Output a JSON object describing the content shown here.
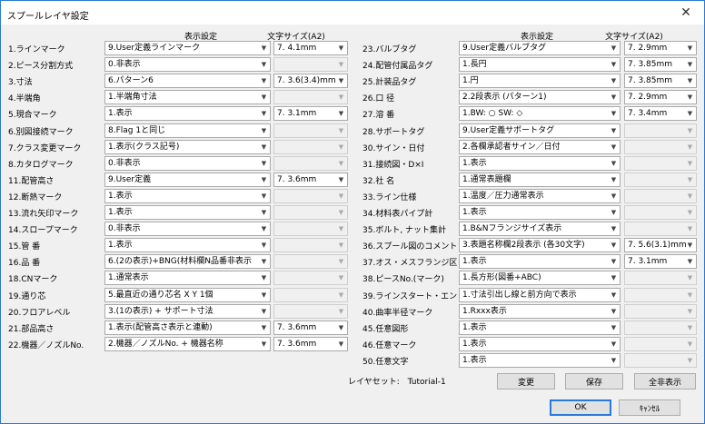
{
  "window": {
    "title": "スプールレイヤ設定",
    "close_glyph": "✕"
  },
  "headers": {
    "left_display": "表示設定",
    "left_size": "文字サイズ(A2)",
    "right_display": "表示設定",
    "right_size": "文字サイズ(A2)"
  },
  "left_rows": [
    {
      "label": "1.ラインマーク",
      "display": "9.User定義ラインマーク",
      "size": "7. 4.1mm",
      "size_enabled": true
    },
    {
      "label": "2.ピース分割方式",
      "display": "0.非表示",
      "size": "",
      "size_enabled": false
    },
    {
      "label": "3.寸法",
      "display": "6.パターン6",
      "size": "7. 3.6(3.4)mm",
      "size_enabled": true
    },
    {
      "label": "4.半端角",
      "display": "1.半端角寸法",
      "size": "",
      "size_enabled": false
    },
    {
      "label": "5.現合マーク",
      "display": "1.表示",
      "size": "7. 3.1mm",
      "size_enabled": true
    },
    {
      "label": "6.別図接続マーク",
      "display": "8.Flag 1と同じ",
      "size": "",
      "size_enabled": false
    },
    {
      "label": "7.クラス変更マーク",
      "display": "1.表示(クラス記号)",
      "size": "",
      "size_enabled": false
    },
    {
      "label": "8.カタログマーク",
      "display": "0.非表示",
      "size": "",
      "size_enabled": false
    },
    {
      "label": "11.配管高さ",
      "display": "9.User定義",
      "size": "7. 3.6mm",
      "size_enabled": true
    },
    {
      "label": "12.断熱マーク",
      "display": "1.表示",
      "size": "",
      "size_enabled": false
    },
    {
      "label": "13.流れ矢印マーク",
      "display": "1.表示",
      "size": "",
      "size_enabled": false
    },
    {
      "label": "14.スロープマーク",
      "display": "0.非表示",
      "size": "",
      "size_enabled": false
    },
    {
      "label": "15.管 番",
      "display": "1.表示",
      "size": "",
      "size_enabled": false
    },
    {
      "label": "16.品 番",
      "display": "6.(2の表示)+BNG(材料欄N品番非表示",
      "size": "",
      "size_enabled": false
    },
    {
      "label": "18.CNマーク",
      "display": "1.通常表示",
      "size": "",
      "size_enabled": false
    },
    {
      "label": "19.通り芯",
      "display": "5.最直近の通り芯名 X Y 1個",
      "size": "",
      "size_enabled": false
    },
    {
      "label": "20.フロアレベル",
      "display": "3.(1の表示) + サポート寸法",
      "size": "",
      "size_enabled": false
    },
    {
      "label": "21.部品高さ",
      "display": "1.表示(配管高さ表示と連動)",
      "size": "7. 3.6mm",
      "size_enabled": true
    },
    {
      "label": "22.機器／ノズルNo.",
      "display": "2.機器／ノズルNo. + 機器名称",
      "size": "7. 3.6mm",
      "size_enabled": true
    }
  ],
  "right_rows": [
    {
      "label": "23.バルブタグ",
      "display": "9.User定義バルブタグ",
      "size": "7. 2.9mm",
      "size_enabled": true
    },
    {
      "label": "24.配管付属品タグ",
      "display": "1.長円",
      "size": "7. 3.85mm",
      "size_enabled": true
    },
    {
      "label": "25.計装品タグ",
      "display": "1.円",
      "size": "7. 3.85mm",
      "size_enabled": true
    },
    {
      "label": "26.口 径",
      "display": "2.2段表示 (パターン1)",
      "size": "7. 2.9mm",
      "size_enabled": true
    },
    {
      "label": "27.溶 番",
      "display": "1.BW: ○ SW: ◇",
      "size": "7. 3.4mm",
      "size_enabled": true
    },
    {
      "label": "28.サポートタグ",
      "display": "9.User定義サポートタグ",
      "size": "",
      "size_enabled": false
    },
    {
      "label": "30.サイン・日付",
      "display": "2.各欄承認者サイン／日付",
      "size": "",
      "size_enabled": false
    },
    {
      "label": "31.接続図・D×I",
      "display": "1.表示",
      "size": "",
      "size_enabled": false
    },
    {
      "label": "32.社 名",
      "display": "1.通常表題欄",
      "size": "",
      "size_enabled": false
    },
    {
      "label": "33.ライン仕様",
      "display": "1.温度／圧力通常表示",
      "size": "",
      "size_enabled": false
    },
    {
      "label": "34.材料表パイプ計",
      "display": "1.表示",
      "size": "",
      "size_enabled": false
    },
    {
      "label": "35.ボルト, ナット集計",
      "display": "1.B&Nフランジサイズ表示",
      "size": "",
      "size_enabled": false
    },
    {
      "label": "36.スプール図のコメント",
      "display": "3.表題名称欄2段表示 (各30文字)",
      "size": "7. 5.6(3.1)mm",
      "size_enabled": true
    },
    {
      "label": "37.オス・メスフランジ区分",
      "display": "1.表示",
      "size": "7. 3.1mm",
      "size_enabled": true
    },
    {
      "label": "38.ピースNo.(マーク)",
      "display": "1.長方形(図番+ABC)",
      "size": "",
      "size_enabled": false
    },
    {
      "label": "39.ラインスタート・エンド",
      "display": "1.寸法引出し線と前方向で表示",
      "size": "",
      "size_enabled": false
    },
    {
      "label": "40.曲率半径マーク",
      "display": "1.Rxxx表示",
      "size": "",
      "size_enabled": false
    },
    {
      "label": "45.任意図形",
      "display": "1.表示",
      "size": "",
      "size_enabled": false
    },
    {
      "label": "46.任意マーク",
      "display": "1.表示",
      "size": "",
      "size_enabled": false
    },
    {
      "label": "50.任意文字",
      "display": "1.表示",
      "size": "",
      "size_enabled": false
    }
  ],
  "footer": {
    "layerset_label": "レイヤセット:",
    "layerset_value": "Tutorial-1",
    "change_button": "変更",
    "save_button": "保存",
    "hide_all_button": "全非表示",
    "ok_button": "OK",
    "cancel_button": "ｷｬﾝｾﾙ"
  },
  "colors": {
    "accent": "#2b79d6",
    "face": "#f0f0f0",
    "button": "#e1e1e1"
  }
}
